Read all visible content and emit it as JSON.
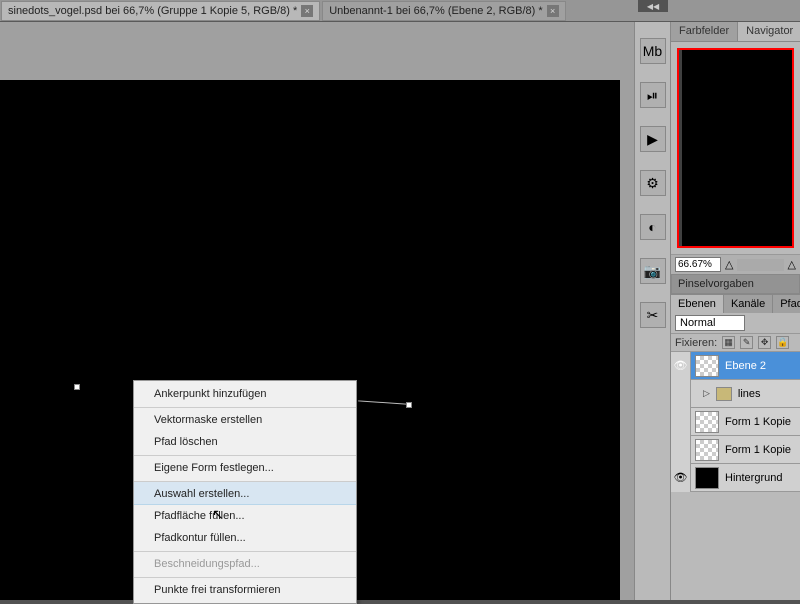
{
  "tabs": [
    {
      "label": "sinedots_vogel.psd bei 66,7% (Gruppe 1 Kopie 5, RGB/8) *"
    },
    {
      "label": "Unbenannt-1 bei 66,7% (Ebene 2, RGB/8) *"
    }
  ],
  "context_menu": {
    "items": [
      {
        "label": "Ankerpunkt hinzufügen",
        "disabled": false,
        "sep": false,
        "hl": false
      },
      {
        "label": "Vektormaske erstellen",
        "disabled": false,
        "sep": true,
        "hl": false
      },
      {
        "label": "Pfad löschen",
        "disabled": false,
        "sep": false,
        "hl": false
      },
      {
        "label": "Eigene Form festlegen...",
        "disabled": false,
        "sep": true,
        "hl": false
      },
      {
        "label": "Auswahl erstellen...",
        "disabled": false,
        "sep": true,
        "hl": true
      },
      {
        "label": "Pfadfläche füllen...",
        "disabled": false,
        "sep": false,
        "hl": false
      },
      {
        "label": "Pfadkontur füllen...",
        "disabled": false,
        "sep": false,
        "hl": false
      },
      {
        "label": "Beschneidungspfad...",
        "disabled": true,
        "sep": true,
        "hl": false
      },
      {
        "label": "Punkte frei transformieren",
        "disabled": false,
        "sep": true,
        "hl": false
      }
    ]
  },
  "panels": {
    "farbfelder": "Farbfelder",
    "navigator": "Navigator",
    "zoom": "66.67%",
    "pinselvorgaben": "Pinselvorgaben",
    "ebenen": "Ebenen",
    "kanale": "Kanäle",
    "pfade": "Pfade",
    "blend_mode": "Normal",
    "fixieren": "Fixieren:"
  },
  "layers": [
    {
      "name": "Ebene 2",
      "selected": true,
      "visible": true,
      "type": "layer"
    },
    {
      "name": "lines",
      "selected": false,
      "visible": true,
      "type": "group"
    },
    {
      "name": "Form 1 Kopie",
      "selected": false,
      "visible": true,
      "type": "layer"
    },
    {
      "name": "Form 1 Kopie",
      "selected": false,
      "visible": true,
      "type": "layer"
    },
    {
      "name": "Hintergrund",
      "selected": false,
      "visible": true,
      "type": "bg"
    }
  ],
  "tool_icons": [
    "Mb",
    "⏯",
    "▶",
    "⚙",
    "◐",
    "📷",
    "✂"
  ]
}
